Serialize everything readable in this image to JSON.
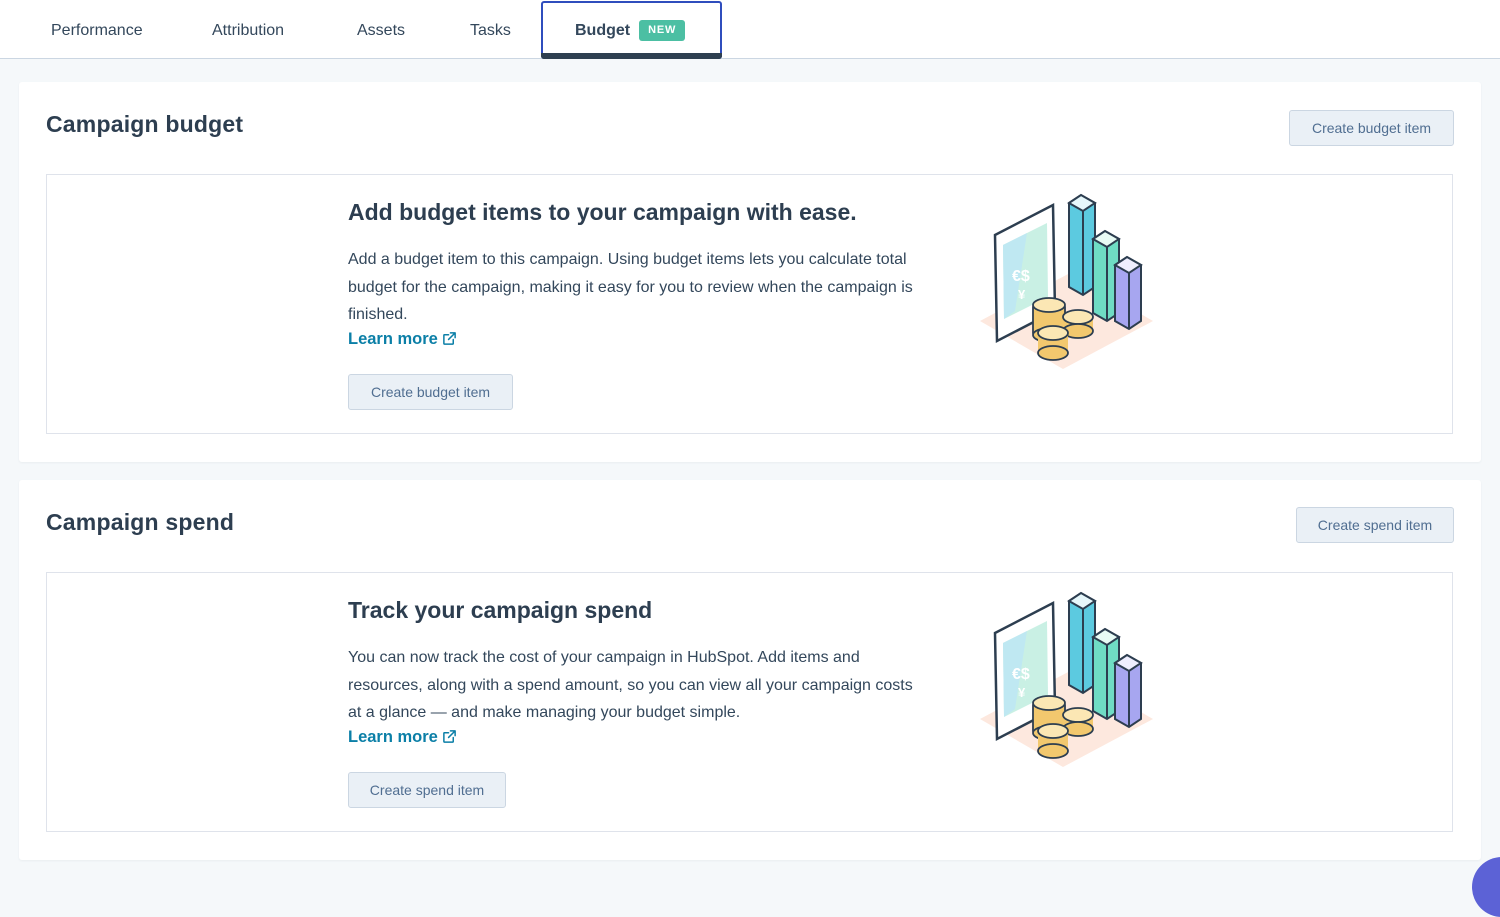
{
  "tabs": {
    "performance": "Performance",
    "attribution": "Attribution",
    "assets": "Assets",
    "tasks": "Tasks",
    "budget": "Budget",
    "budget_badge": "NEW"
  },
  "budget": {
    "title": "Campaign budget",
    "header_button": "Create budget item",
    "empty_title": "Add budget items to your campaign with ease.",
    "empty_text": "Add a budget item to this campaign. Using budget items lets you calculate total budget for the campaign, making it easy for you to review when the campaign is finished.",
    "learn_more": "Learn more",
    "empty_button": "Create budget item"
  },
  "spend": {
    "title": "Campaign spend",
    "header_button": "Create spend item",
    "empty_title": "Track your campaign spend",
    "empty_text": "You can now track the cost of your campaign in HubSpot. Add items and resources, along with a spend amount, so you can view all your campaign costs at a glance — and make managing your budget simple.",
    "learn_more": "Learn more",
    "empty_button": "Create spend item"
  },
  "icons": {
    "external_link": "external-link-icon",
    "illustration": "budget-chart-coins-illustration",
    "currency_symbols": "€ $ ¥"
  },
  "colors": {
    "accent_tab": "#2f4dbd",
    "badge": "#4cbfa3",
    "link": "#0b7fa7",
    "button_bg": "#eaf0f6"
  }
}
